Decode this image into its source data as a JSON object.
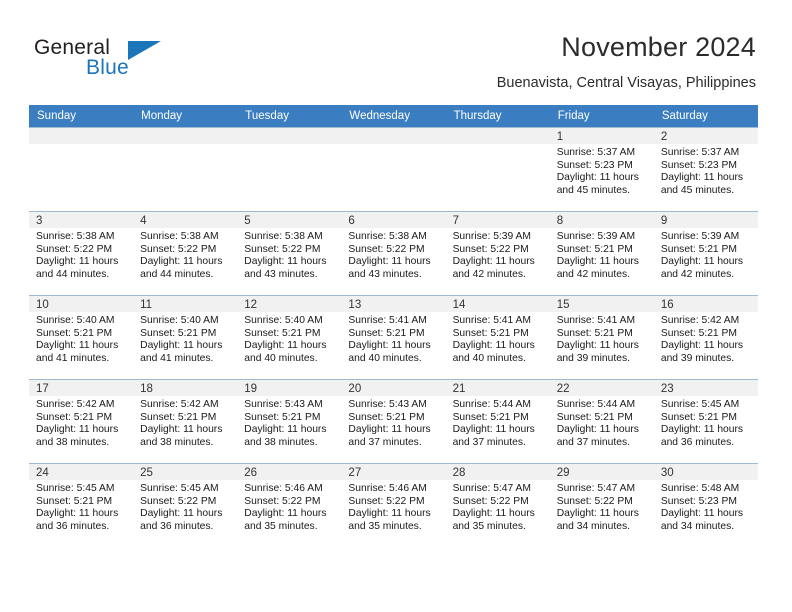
{
  "brand": {
    "name_top": "General",
    "name_bottom": "Blue",
    "color_primary": "#1b75bb"
  },
  "header": {
    "title": "November 2024",
    "subtitle": "Buenavista, Central Visayas, Philippines"
  },
  "calendar": {
    "header_background": "#3a7ec1",
    "weekday_headers": [
      "Sunday",
      "Monday",
      "Tuesday",
      "Wednesday",
      "Thursday",
      "Friday",
      "Saturday"
    ],
    "weeks": [
      [
        {
          "date": "",
          "sunrise": "",
          "sunset": "",
          "daylight_line1": "",
          "daylight_line2": ""
        },
        {
          "date": "",
          "sunrise": "",
          "sunset": "",
          "daylight_line1": "",
          "daylight_line2": ""
        },
        {
          "date": "",
          "sunrise": "",
          "sunset": "",
          "daylight_line1": "",
          "daylight_line2": ""
        },
        {
          "date": "",
          "sunrise": "",
          "sunset": "",
          "daylight_line1": "",
          "daylight_line2": ""
        },
        {
          "date": "",
          "sunrise": "",
          "sunset": "",
          "daylight_line1": "",
          "daylight_line2": ""
        },
        {
          "date": "1",
          "sunrise": "Sunrise: 5:37 AM",
          "sunset": "Sunset: 5:23 PM",
          "daylight_line1": "Daylight: 11 hours",
          "daylight_line2": "and 45 minutes."
        },
        {
          "date": "2",
          "sunrise": "Sunrise: 5:37 AM",
          "sunset": "Sunset: 5:23 PM",
          "daylight_line1": "Daylight: 11 hours",
          "daylight_line2": "and 45 minutes."
        }
      ],
      [
        {
          "date": "3",
          "sunrise": "Sunrise: 5:38 AM",
          "sunset": "Sunset: 5:22 PM",
          "daylight_line1": "Daylight: 11 hours",
          "daylight_line2": "and 44 minutes."
        },
        {
          "date": "4",
          "sunrise": "Sunrise: 5:38 AM",
          "sunset": "Sunset: 5:22 PM",
          "daylight_line1": "Daylight: 11 hours",
          "daylight_line2": "and 44 minutes."
        },
        {
          "date": "5",
          "sunrise": "Sunrise: 5:38 AM",
          "sunset": "Sunset: 5:22 PM",
          "daylight_line1": "Daylight: 11 hours",
          "daylight_line2": "and 43 minutes."
        },
        {
          "date": "6",
          "sunrise": "Sunrise: 5:38 AM",
          "sunset": "Sunset: 5:22 PM",
          "daylight_line1": "Daylight: 11 hours",
          "daylight_line2": "and 43 minutes."
        },
        {
          "date": "7",
          "sunrise": "Sunrise: 5:39 AM",
          "sunset": "Sunset: 5:22 PM",
          "daylight_line1": "Daylight: 11 hours",
          "daylight_line2": "and 42 minutes."
        },
        {
          "date": "8",
          "sunrise": "Sunrise: 5:39 AM",
          "sunset": "Sunset: 5:21 PM",
          "daylight_line1": "Daylight: 11 hours",
          "daylight_line2": "and 42 minutes."
        },
        {
          "date": "9",
          "sunrise": "Sunrise: 5:39 AM",
          "sunset": "Sunset: 5:21 PM",
          "daylight_line1": "Daylight: 11 hours",
          "daylight_line2": "and 42 minutes."
        }
      ],
      [
        {
          "date": "10",
          "sunrise": "Sunrise: 5:40 AM",
          "sunset": "Sunset: 5:21 PM",
          "daylight_line1": "Daylight: 11 hours",
          "daylight_line2": "and 41 minutes."
        },
        {
          "date": "11",
          "sunrise": "Sunrise: 5:40 AM",
          "sunset": "Sunset: 5:21 PM",
          "daylight_line1": "Daylight: 11 hours",
          "daylight_line2": "and 41 minutes."
        },
        {
          "date": "12",
          "sunrise": "Sunrise: 5:40 AM",
          "sunset": "Sunset: 5:21 PM",
          "daylight_line1": "Daylight: 11 hours",
          "daylight_line2": "and 40 minutes."
        },
        {
          "date": "13",
          "sunrise": "Sunrise: 5:41 AM",
          "sunset": "Sunset: 5:21 PM",
          "daylight_line1": "Daylight: 11 hours",
          "daylight_line2": "and 40 minutes."
        },
        {
          "date": "14",
          "sunrise": "Sunrise: 5:41 AM",
          "sunset": "Sunset: 5:21 PM",
          "daylight_line1": "Daylight: 11 hours",
          "daylight_line2": "and 40 minutes."
        },
        {
          "date": "15",
          "sunrise": "Sunrise: 5:41 AM",
          "sunset": "Sunset: 5:21 PM",
          "daylight_line1": "Daylight: 11 hours",
          "daylight_line2": "and 39 minutes."
        },
        {
          "date": "16",
          "sunrise": "Sunrise: 5:42 AM",
          "sunset": "Sunset: 5:21 PM",
          "daylight_line1": "Daylight: 11 hours",
          "daylight_line2": "and 39 minutes."
        }
      ],
      [
        {
          "date": "17",
          "sunrise": "Sunrise: 5:42 AM",
          "sunset": "Sunset: 5:21 PM",
          "daylight_line1": "Daylight: 11 hours",
          "daylight_line2": "and 38 minutes."
        },
        {
          "date": "18",
          "sunrise": "Sunrise: 5:42 AM",
          "sunset": "Sunset: 5:21 PM",
          "daylight_line1": "Daylight: 11 hours",
          "daylight_line2": "and 38 minutes."
        },
        {
          "date": "19",
          "sunrise": "Sunrise: 5:43 AM",
          "sunset": "Sunset: 5:21 PM",
          "daylight_line1": "Daylight: 11 hours",
          "daylight_line2": "and 38 minutes."
        },
        {
          "date": "20",
          "sunrise": "Sunrise: 5:43 AM",
          "sunset": "Sunset: 5:21 PM",
          "daylight_line1": "Daylight: 11 hours",
          "daylight_line2": "and 37 minutes."
        },
        {
          "date": "21",
          "sunrise": "Sunrise: 5:44 AM",
          "sunset": "Sunset: 5:21 PM",
          "daylight_line1": "Daylight: 11 hours",
          "daylight_line2": "and 37 minutes."
        },
        {
          "date": "22",
          "sunrise": "Sunrise: 5:44 AM",
          "sunset": "Sunset: 5:21 PM",
          "daylight_line1": "Daylight: 11 hours",
          "daylight_line2": "and 37 minutes."
        },
        {
          "date": "23",
          "sunrise": "Sunrise: 5:45 AM",
          "sunset": "Sunset: 5:21 PM",
          "daylight_line1": "Daylight: 11 hours",
          "daylight_line2": "and 36 minutes."
        }
      ],
      [
        {
          "date": "24",
          "sunrise": "Sunrise: 5:45 AM",
          "sunset": "Sunset: 5:21 PM",
          "daylight_line1": "Daylight: 11 hours",
          "daylight_line2": "and 36 minutes."
        },
        {
          "date": "25",
          "sunrise": "Sunrise: 5:45 AM",
          "sunset": "Sunset: 5:22 PM",
          "daylight_line1": "Daylight: 11 hours",
          "daylight_line2": "and 36 minutes."
        },
        {
          "date": "26",
          "sunrise": "Sunrise: 5:46 AM",
          "sunset": "Sunset: 5:22 PM",
          "daylight_line1": "Daylight: 11 hours",
          "daylight_line2": "and 35 minutes."
        },
        {
          "date": "27",
          "sunrise": "Sunrise: 5:46 AM",
          "sunset": "Sunset: 5:22 PM",
          "daylight_line1": "Daylight: 11 hours",
          "daylight_line2": "and 35 minutes."
        },
        {
          "date": "28",
          "sunrise": "Sunrise: 5:47 AM",
          "sunset": "Sunset: 5:22 PM",
          "daylight_line1": "Daylight: 11 hours",
          "daylight_line2": "and 35 minutes."
        },
        {
          "date": "29",
          "sunrise": "Sunrise: 5:47 AM",
          "sunset": "Sunset: 5:22 PM",
          "daylight_line1": "Daylight: 11 hours",
          "daylight_line2": "and 34 minutes."
        },
        {
          "date": "30",
          "sunrise": "Sunrise: 5:48 AM",
          "sunset": "Sunset: 5:23 PM",
          "daylight_line1": "Daylight: 11 hours",
          "daylight_line2": "and 34 minutes."
        }
      ]
    ]
  }
}
